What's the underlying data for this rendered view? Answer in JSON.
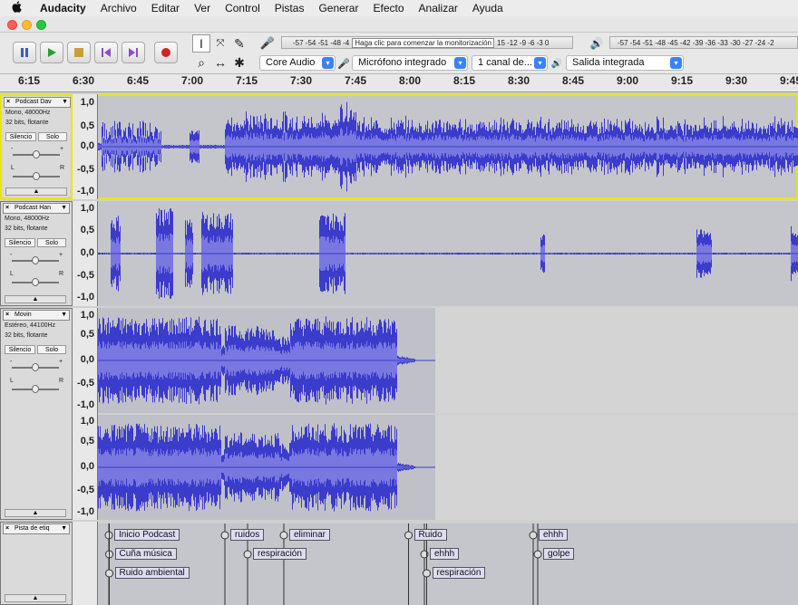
{
  "menu": {
    "apple": "",
    "items": [
      "Audacity",
      "Archivo",
      "Editar",
      "Ver",
      "Control",
      "Pistas",
      "Generar",
      "Efecto",
      "Analizar",
      "Ayuda"
    ]
  },
  "meters": {
    "record_prompt": "Haga clic para comenzar la monitorización",
    "record_scale_left": "-57 -54 -51 -48 -4",
    "record_scale_right": "15 -12 -9 -6 -3 0",
    "play_scale": "-57 -54 -51 -48 -45 -42 -39 -36 -33 -30 -27 -24 -2"
  },
  "devices": {
    "host": "Core Audio",
    "input": "Micrófono integrado",
    "channels": "1 canal de...",
    "output": "Salida integrada"
  },
  "ruler": {
    "ticks": [
      "6:15",
      "6:30",
      "6:45",
      "7:00",
      "7:15",
      "7:30",
      "7:45",
      "8:00",
      "8:15",
      "8:30",
      "8:45",
      "9:00",
      "9:15",
      "9:30",
      "9:45"
    ]
  },
  "tracks": [
    {
      "name": "Podcast Dav",
      "rate": "Mono, 48000Hz",
      "format": "32 bits, flotante",
      "mute": "Silencio",
      "solo": "Solo",
      "gain_minus": "-",
      "gain_plus": "+",
      "pan_l": "L",
      "pan_r": "R"
    },
    {
      "name": "Podcast Han",
      "rate": "Mono, 48000Hz",
      "format": "32 bits, flotante",
      "mute": "Silencio",
      "solo": "Solo",
      "gain_minus": "-",
      "gain_plus": "+",
      "pan_l": "L",
      "pan_r": "R"
    },
    {
      "name": "Movin",
      "rate": "Estéreo, 44100Hz",
      "format": "32 bits, flotante",
      "mute": "Silencio",
      "solo": "Solo",
      "gain_minus": "-",
      "gain_plus": "+",
      "pan_l": "L",
      "pan_r": "R"
    }
  ],
  "label_track": {
    "name": "Pista de etiq"
  },
  "y_ticks": [
    "1,0",
    "0,5",
    "0,0",
    "-0,5",
    "-1,0"
  ],
  "labels": [
    {
      "text": "Inicio Podcast",
      "x": 0.24,
      "row": 0
    },
    {
      "text": "Cuña música",
      "x": 0.25,
      "row": 1
    },
    {
      "text": "Ruido ambiental",
      "x": 0.25,
      "row": 2
    },
    {
      "text": "ruidos",
      "x": 2.8,
      "row": 0
    },
    {
      "text": "respiración",
      "x": 3.3,
      "row": 1
    },
    {
      "text": "eliminar",
      "x": 4.1,
      "row": 0
    },
    {
      "text": "Ruido",
      "x": 6.85,
      "row": 0
    },
    {
      "text": "ehhh",
      "x": 7.2,
      "row": 1
    },
    {
      "text": "respiración",
      "x": 7.25,
      "row": 2
    },
    {
      "text": "ehhh",
      "x": 9.6,
      "row": 0
    },
    {
      "text": "golpe",
      "x": 9.7,
      "row": 1
    }
  ],
  "colors": {
    "wave": "#3b3bcc",
    "wave_light": "#7878e0",
    "selected": "#e8e800",
    "track_bg": "#c5c5cc"
  }
}
